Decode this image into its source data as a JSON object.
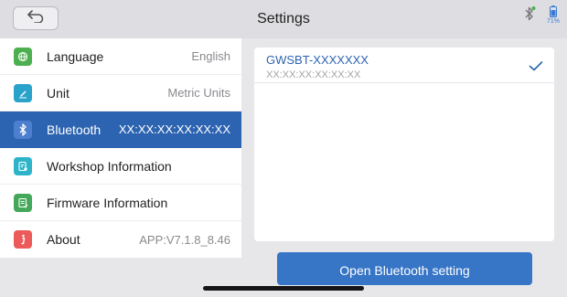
{
  "header": {
    "title": "Settings",
    "back_icon": "back-arrow-icon",
    "battery_percent": "71%"
  },
  "menu": [
    {
      "label": "Language",
      "value": "English",
      "icon": "language-globe-icon",
      "icon_color": "#4caf50"
    },
    {
      "label": "Unit",
      "value": "Metric Units",
      "icon": "unit-pencil-icon",
      "icon_color": "#29a3c9"
    },
    {
      "label": "Bluetooth",
      "value": "XX:XX:XX:XX:XX:XX",
      "icon": "bluetooth-icon",
      "icon_color": "#4d7fd0"
    },
    {
      "label": "Workshop Information",
      "value": "",
      "icon": "workshop-icon",
      "icon_color": "#2db4c8"
    },
    {
      "label": "Firmware Information",
      "value": "",
      "icon": "firmware-icon",
      "icon_color": "#43a85a"
    },
    {
      "label": "About",
      "value": "APP:V7.1.8_8.46",
      "icon": "about-info-icon",
      "icon_color": "#ec5a5a"
    }
  ],
  "device": {
    "name": "GWSBT-XXXXXXX",
    "address": "XX:XX:XX:XX:XX:XX"
  },
  "actions": {
    "open_bluetooth_label": "Open Bluetooth setting"
  },
  "colors": {
    "accent": "#2d64b1",
    "button": "#3775c6",
    "battery": "#3a7bd5"
  }
}
